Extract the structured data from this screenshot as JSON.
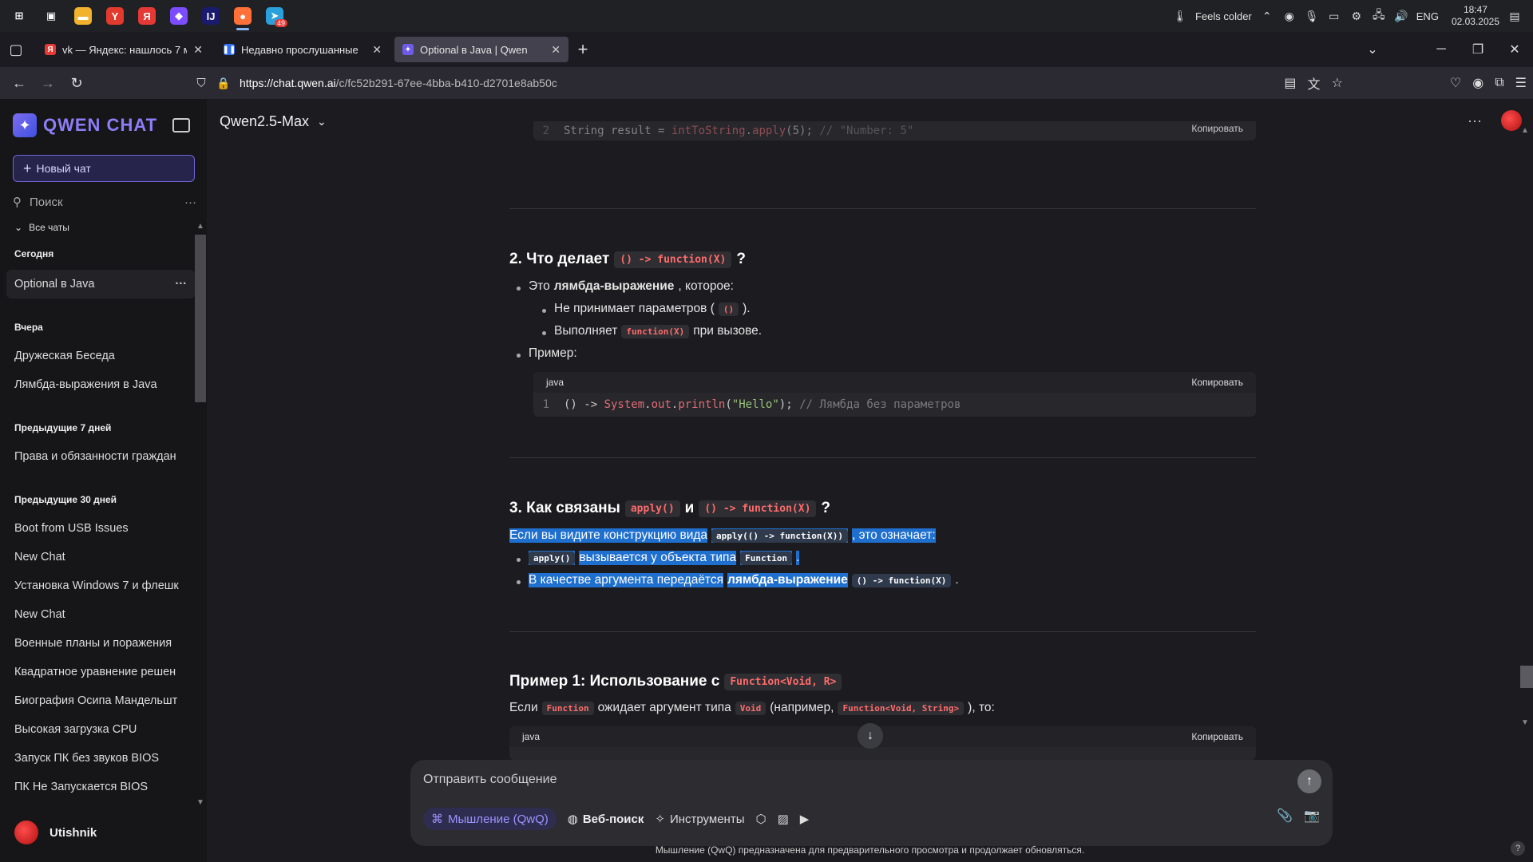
{
  "taskbar": {
    "apps": [
      {
        "name": "windows-start-icon",
        "glyph": "⊞",
        "color": "#202124"
      },
      {
        "name": "task-view-icon",
        "glyph": "▣",
        "color": "#202124"
      },
      {
        "name": "file-explorer-icon",
        "glyph": "▬",
        "color": "#f2b22e"
      },
      {
        "name": "yandex-browser-icon",
        "glyph": "Y",
        "color": "#e23b2e"
      },
      {
        "name": "yandex-icon",
        "glyph": "Я",
        "color": "#e53935"
      },
      {
        "name": "obsidian-icon",
        "glyph": "◆",
        "color": "#7c4dff"
      },
      {
        "name": "intellij-icon",
        "glyph": "IJ",
        "color": "#1a1a6e"
      },
      {
        "name": "firefox-icon",
        "glyph": "●",
        "color": "#ff7139"
      },
      {
        "name": "telegram-icon",
        "glyph": "➤",
        "color": "#2aa1da"
      }
    ],
    "telegram_badge": "49",
    "weather": "Feels colder",
    "lang": "ENG",
    "time": "18:47",
    "date": "02.03.2025"
  },
  "tabs": [
    {
      "title": "vk — Яндекс: нашлось 7 млн р",
      "favicon": "Я",
      "favcolor": "#e53935"
    },
    {
      "title": "Недавно прослушанные",
      "favicon": "❚❚",
      "favcolor": "#2d6cf5"
    },
    {
      "title": "Optional в Java | Qwen",
      "favicon": "✦",
      "favcolor": "#6e5ce6"
    }
  ],
  "url": {
    "host": "https://chat.qwen.ai",
    "path": "/c/fc52b291-67ee-4bba-b410-d2701e8ab50c"
  },
  "sidebar": {
    "brand": "QWEN CHAT",
    "new_chat": "Новый чат",
    "search_placeholder": "Поиск",
    "all_chats": "Все чаты",
    "today": "Сегодня",
    "today_items": [
      "Optional в Java"
    ],
    "yesterday": "Вчера",
    "yesterday_items": [
      "Дружеская Беседа",
      "Лямбда-выражения в Java"
    ],
    "week": "Предыдущие 7 дней",
    "week_items": [
      "Права и обязанности граждан"
    ],
    "month": "Предыдущие 30 дней",
    "month_items": [
      "Boot from USB Issues",
      "New Chat",
      "Установка Windows 7 и флешк",
      "New Chat",
      "Военные планы и поражения",
      "Квадратное уравнение решен",
      "Биография Осипа Мандельшт",
      "Высокая загрузка CPU",
      "Запуск ПК без звуков BIOS",
      "ПК Не Запускается BIOS"
    ],
    "user": "Utishnik"
  },
  "main": {
    "model": "Qwen2.5-Max",
    "copy": "Копировать",
    "code1": {
      "ln": "2",
      "a": "String result = ",
      "b": "intToString",
      "c": ".",
      "d": "apply",
      "e": "(5); ",
      "f": "// \"Number: 5\""
    },
    "s2": {
      "title_a": "2. Что делает",
      "title_code": "() -> function(X)",
      "title_b": "?",
      "b1_a": "Это",
      "b1_bold": "лямбда-выражение",
      "b1_b": ", которое:",
      "b1a_a": "Не принимает параметров (",
      "b1a_code": "()",
      "b1a_b": ").",
      "b1b_a": "Выполняет",
      "b1b_code": "function(X)",
      "b1b_b": "при вызове.",
      "b2": "Пример:",
      "lang": "java",
      "code": {
        "ln": "1",
        "a": "() -> ",
        "b": "System",
        "c": ".",
        "d": "out",
        "e": ".",
        "f": "println",
        "g": "(",
        "h": "\"Hello\"",
        "i": "); ",
        "j": "// Лямбда без параметров"
      }
    },
    "s3": {
      "title_a": "3. Как связаны",
      "title_code1": "apply()",
      "title_b": "и",
      "title_code2": "() -> function(X)",
      "title_c": "?",
      "p_a": "Если вы видите конструкцию вида",
      "p_code": "apply(() -> function(X))",
      "p_b": ", это означает:",
      "b1_code": "apply()",
      "b1_a": "вызывается у объекта типа",
      "b1_code2": "Function",
      "b1_b": ".",
      "b2_a": "В качестве аргумента передаётся",
      "b2_bold": "лямбда-выражение",
      "b2_code": "() -> function(X)",
      "b2_b": "."
    },
    "ex1": {
      "title_a": "Пример 1: Использование с",
      "title_code": "Function<Void, R>",
      "p_a": "Если",
      "p_code1": "Function",
      "p_b": "ожидает аргумент типа",
      "p_code2": "Void",
      "p_c": "(например,",
      "p_code3": "Function<Void, String>",
      "p_d": "), то:",
      "lang": "java"
    },
    "input_placeholder": "Отправить сообщение",
    "tools": {
      "thinking": "Мышление (QwQ)",
      "web": "Веб-поиск",
      "instr": "Инструменты"
    },
    "footer": "Мышление (QwQ) предназначена для предварительного просмотра и продолжает обновляться."
  }
}
